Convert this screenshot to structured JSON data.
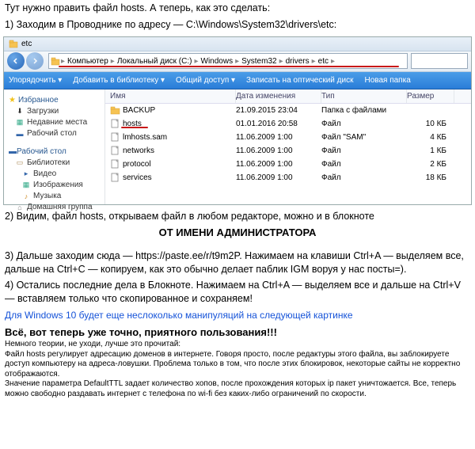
{
  "intro": {
    "line1": "Тут нужно править файл hosts. А теперь, как это сделать:",
    "line2": "1) Заходим в Проводнике по адресу — C:\\Windows\\System32\\drivers\\etc:"
  },
  "window": {
    "title": "etc",
    "breadcrumbs": [
      "Компьютер",
      "Локальный диск (C:)",
      "Windows",
      "System32",
      "drivers",
      "etc"
    ],
    "toolbar": {
      "organize": "Упорядочить ▾",
      "addlib": "Добавить в библиотеку ▾",
      "share": "Общий доступ ▾",
      "burn": "Записать на оптический диск",
      "newfolder": "Новая папка"
    },
    "sidebar": {
      "groups": [
        {
          "label": "Избранное",
          "items": [
            "Загрузки",
            "Недавние места",
            "Рабочий стол"
          ]
        },
        {
          "label": "Рабочий стол",
          "items": [
            "Библиотеки",
            "Видео",
            "Изображения",
            "Музыка",
            "Домашняя группа"
          ]
        }
      ]
    },
    "columns": {
      "name": "Имя",
      "date": "Дата изменения",
      "type": "Тип",
      "size": "Размер"
    },
    "files": [
      {
        "name": "BACKUP",
        "date": "21.09.2015 23:04",
        "type": "Папка с файлами",
        "size": "",
        "folder": true
      },
      {
        "name": "hosts",
        "date": "01.01.2016 20:58",
        "type": "Файл",
        "size": "10 КБ",
        "highlight": true
      },
      {
        "name": "lmhosts.sam",
        "date": "11.06.2009 1:00",
        "type": "Файл \"SAM\"",
        "size": "4 КБ"
      },
      {
        "name": "networks",
        "date": "11.06.2009 1:00",
        "type": "Файл",
        "size": "1 КБ"
      },
      {
        "name": "protocol",
        "date": "11.06.2009 1:00",
        "type": "Файл",
        "size": "2 КБ"
      },
      {
        "name": "services",
        "date": "11.06.2009 1:00",
        "type": "Файл",
        "size": "18 КБ"
      }
    ]
  },
  "step2": {
    "text": "2) Видим, файл hosts, открываем файл в любом редакторе, можно и в блокноте",
    "admin": "ОТ ИМЕНИ АДМИНИСТРАТОРА"
  },
  "step3": "3) Дальше заходим сюда — https://paste.ee/r/t9m2P. Нажимаем на клавиши Ctrl+A — выделяем все, дальше на Ctrl+C — копируем, как это обычно делает паблик IGM воруя у нас посты=).",
  "step4": "4) Остались последние дела в Блокноте. Нажимаем на Ctrl+A — выделяем все и дальше на Ctrl+V — вставляем только что скопированное и сохраняем!",
  "win10": "Для Windows 10 будет еще неслоколько манипуляций на следующей картинке",
  "final": "Всё, вот теперь уже точно, приятного пользования!!!",
  "theory": {
    "l1": "Немного теории, не уходи, лучше это прочитай:",
    "l2": "Файл hosts регулирует адресацию доменов в интернете. Говоря просто, после редактуры этого файла, вы заблокируете доступ компьютеру на адреса-ловушки. Проблема только в том, что после этих блокировок, некоторые сайты не корректно отображаются.",
    "l3": "Значение параметра DefaultTTL задает количество хопов, после прохождения которых ip пакет уничтожается. Все, теперь можно свободно раздавать интернет с телефона по wi-fi без каких-либо ограничений по скорости."
  }
}
